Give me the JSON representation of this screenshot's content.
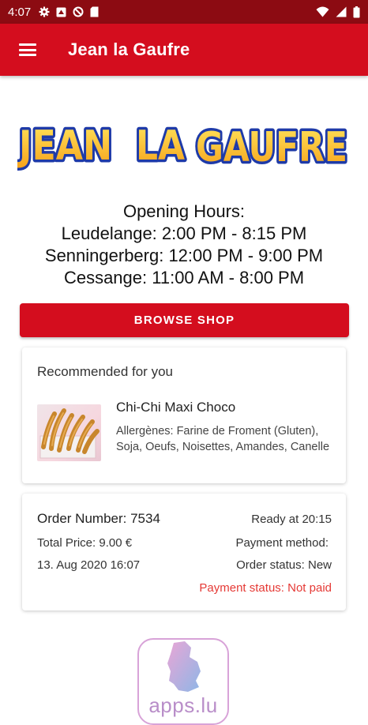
{
  "status_bar": {
    "time": "4:07",
    "left_icons": [
      "gear-icon",
      "sync-icon",
      "blocked-icon",
      "sd-card-icon"
    ],
    "right_icons": [
      "wifi-icon",
      "signal-icon",
      "battery-icon"
    ]
  },
  "app_bar": {
    "title": "Jean la Gaufre",
    "menu_icon": "hamburger-menu-icon",
    "color": "#d40d1e"
  },
  "logo": {
    "text": "JEAN LA GAUFRE"
  },
  "opening_hours": {
    "heading": "Opening Hours:",
    "lines": [
      "Leudelange: 2:00 PM - 8:15 PM",
      "Senningerberg: 12:00 PM - 9:00 PM",
      "Cessange: 11:00 AM - 8:00 PM"
    ]
  },
  "browse_button": {
    "label": "BROWSE SHOP"
  },
  "recommended": {
    "title": "Recommended for you",
    "product_name": "Chi-Chi Maxi Choco",
    "allergens": "Allergènes: Farine de Froment (Gluten), Soja, Oeufs, Noisettes, Amandes, Canelle"
  },
  "order": {
    "number": "Order Number: 7534",
    "ready": "Ready at 20:15",
    "total_price": "Total Price: 9.00 €",
    "payment_method": "Payment method:",
    "date": "13. Aug 2020 16:07",
    "order_status": "Order status: New",
    "payment_status": "Payment status: Not paid",
    "payment_status_color": "#e53935"
  },
  "footer_badge": {
    "text": "apps.lu"
  }
}
